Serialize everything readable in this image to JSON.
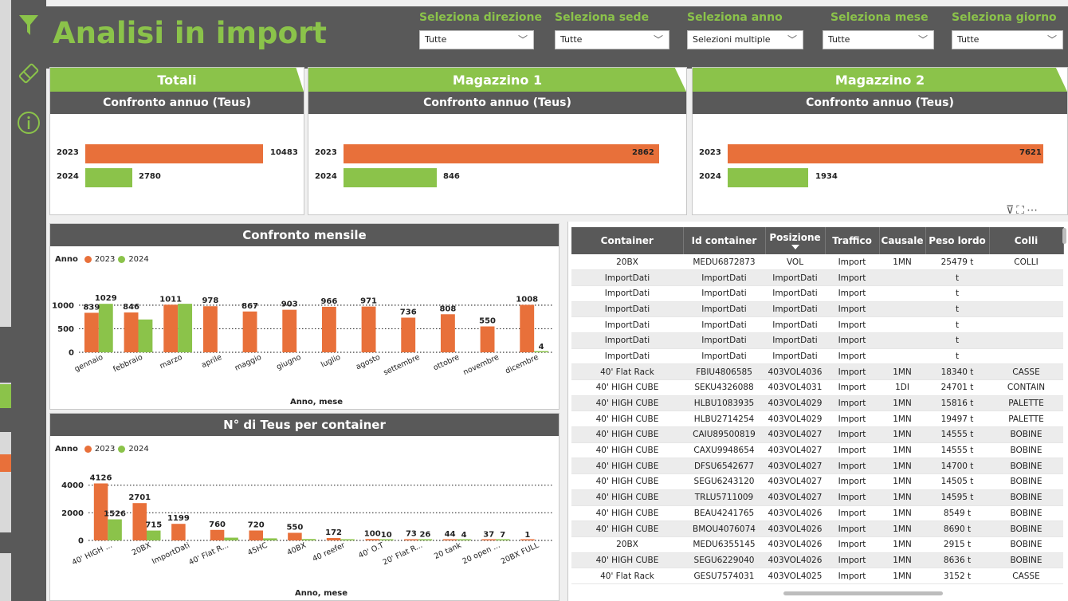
{
  "colors": {
    "c2023": "#e8703a",
    "c2024": "#8bc34a",
    "dark": "#595959",
    "accent": "#8bc34a"
  },
  "header": {
    "title": "Analisi in import"
  },
  "slicers": [
    {
      "label": "Seleziona direzione",
      "value": "Tutte"
    },
    {
      "label": "Seleziona sede",
      "value": "Tutte"
    },
    {
      "label": "Seleziona anno",
      "value": "Selezioni multiple"
    },
    {
      "label": "Seleziona mese",
      "value": "Tutte"
    },
    {
      "label": "Seleziona giorno",
      "value": "Tutte"
    }
  ],
  "sidebar": {
    "icons": [
      "filter-icon",
      "eraser-icon",
      "info-icon"
    ]
  },
  "kpi": [
    {
      "tab": "Totali",
      "subtitle": "Confronto annuo (Teus)",
      "rows": [
        {
          "year": "2023",
          "value": 10483
        },
        {
          "year": "2024",
          "value": 2780
        }
      ]
    },
    {
      "tab": "Magazzino 1",
      "subtitle": "Confronto annuo (Teus)",
      "rows": [
        {
          "year": "2023",
          "value": 2862
        },
        {
          "year": "2024",
          "value": 846
        }
      ]
    },
    {
      "tab": "Magazzino 2",
      "subtitle": "Confronto annuo (Teus)",
      "rows": [
        {
          "year": "2023",
          "value": 7621
        },
        {
          "year": "2024",
          "value": 1934
        }
      ]
    }
  ],
  "legend": {
    "title": "Anno",
    "s2023": "2023",
    "s2024": "2024"
  },
  "chart_data": [
    {
      "type": "bar",
      "title": "Confronto mensile",
      "xlabel": "Anno, mese",
      "ylabel": "",
      "ylim": [
        0,
        1100
      ],
      "yticks": [
        0,
        500,
        1000
      ],
      "categories": [
        "gennaio",
        "febbraio",
        "marzo",
        "aprile",
        "maggio",
        "giugno",
        "luglio",
        "agosto",
        "settembre",
        "ottobre",
        "novembre",
        "dicembre"
      ],
      "series": [
        {
          "name": "2023",
          "values": [
            839,
            846,
            1011,
            978,
            867,
            903,
            966,
            971,
            736,
            808,
            550,
            1008
          ]
        },
        {
          "name": "2024",
          "values": [
            1029,
            697,
            1030,
            null,
            null,
            null,
            null,
            null,
            null,
            null,
            null,
            4
          ]
        }
      ]
    },
    {
      "type": "bar",
      "title": "N° di Teus per container",
      "xlabel": "Anno, mese",
      "ylabel": "",
      "ylim": [
        0,
        4500
      ],
      "yticks": [
        0,
        2000,
        4000
      ],
      "categories": [
        "40' HIGH ...",
        "20BX",
        "ImportDati",
        "40' Flat R...",
        "45HC",
        "40BX",
        "40 reefer",
        "40' O.T",
        "20' Flat R...",
        "20 tank",
        "20 open ...",
        "20BX FULL"
      ],
      "series": [
        {
          "name": "2023",
          "values": [
            4126,
            2701,
            1199,
            760,
            720,
            550,
            172,
            100,
            73,
            44,
            37,
            1
          ]
        },
        {
          "name": "2024",
          "values": [
            1526,
            715,
            null,
            200,
            150,
            100,
            40,
            10,
            26,
            4,
            7,
            null
          ]
        }
      ]
    }
  ],
  "table": {
    "columns": [
      "Container",
      "Id container",
      "Posizione",
      "Traffico",
      "Causale",
      "Peso lordo",
      "Colli"
    ],
    "rows": [
      [
        "20BX",
        "MEDU6872873",
        "VOL",
        "Import",
        "1MN",
        "25479 t",
        "COLLI"
      ],
      [
        "ImportDati",
        "ImportDati",
        "ImportDati",
        "Import",
        "",
        "t",
        ""
      ],
      [
        "ImportDati",
        "ImportDati",
        "ImportDati",
        "Import",
        "",
        "t",
        ""
      ],
      [
        "ImportDati",
        "ImportDati",
        "ImportDati",
        "Import",
        "",
        "t",
        ""
      ],
      [
        "ImportDati",
        "ImportDati",
        "ImportDati",
        "Import",
        "",
        "t",
        ""
      ],
      [
        "ImportDati",
        "ImportDati",
        "ImportDati",
        "Import",
        "",
        "t",
        ""
      ],
      [
        "ImportDati",
        "ImportDati",
        "ImportDati",
        "Import",
        "",
        "t",
        ""
      ],
      [
        "40' Flat Rack",
        "FBIU4806585",
        "403VOL4036",
        "Import",
        "1MN",
        "18340 t",
        "CASSE"
      ],
      [
        "40' HIGH CUBE",
        "SEKU4326088",
        "403VOL4031",
        "Import",
        "1DI",
        "24701 t",
        "CONTAIN"
      ],
      [
        "40' HIGH CUBE",
        "HLBU1083935",
        "403VOL4029",
        "Import",
        "1MN",
        "15816 t",
        "PALETTE"
      ],
      [
        "40' HIGH CUBE",
        "HLBU2714254",
        "403VOL4029",
        "Import",
        "1MN",
        "19497 t",
        "PALETTE"
      ],
      [
        "40' HIGH CUBE",
        "CAIU89500819",
        "403VOL4027",
        "Import",
        "1MN",
        "14555 t",
        "BOBINE"
      ],
      [
        "40' HIGH CUBE",
        "CAXU9948654",
        "403VOL4027",
        "Import",
        "1MN",
        "14555 t",
        "BOBINE"
      ],
      [
        "40' HIGH CUBE",
        "DFSU6542677",
        "403VOL4027",
        "Import",
        "1MN",
        "14700 t",
        "BOBINE"
      ],
      [
        "40' HIGH CUBE",
        "SEGU6243120",
        "403VOL4027",
        "Import",
        "1MN",
        "14505 t",
        "BOBINE"
      ],
      [
        "40' HIGH CUBE",
        "TRLU5711009",
        "403VOL4027",
        "Import",
        "1MN",
        "14595 t",
        "BOBINE"
      ],
      [
        "40' HIGH CUBE",
        "BEAU4241765",
        "403VOL4026",
        "Import",
        "1MN",
        "8549 t",
        "BOBINE"
      ],
      [
        "40' HIGH CUBE",
        "BMOU4076074",
        "403VOL4026",
        "Import",
        "1MN",
        "8690 t",
        "BOBINE"
      ],
      [
        "20BX",
        "MEDU6355145",
        "403VOL4026",
        "Import",
        "1MN",
        "2915 t",
        "BOBINE"
      ],
      [
        "40' HIGH CUBE",
        "SEGU6229040",
        "403VOL4026",
        "Import",
        "1MN",
        "8636 t",
        "BOBINE"
      ],
      [
        "40' Flat Rack",
        "GESU7574031",
        "403VOL4025",
        "Import",
        "1MN",
        "3152 t",
        "CASSE"
      ]
    ]
  }
}
